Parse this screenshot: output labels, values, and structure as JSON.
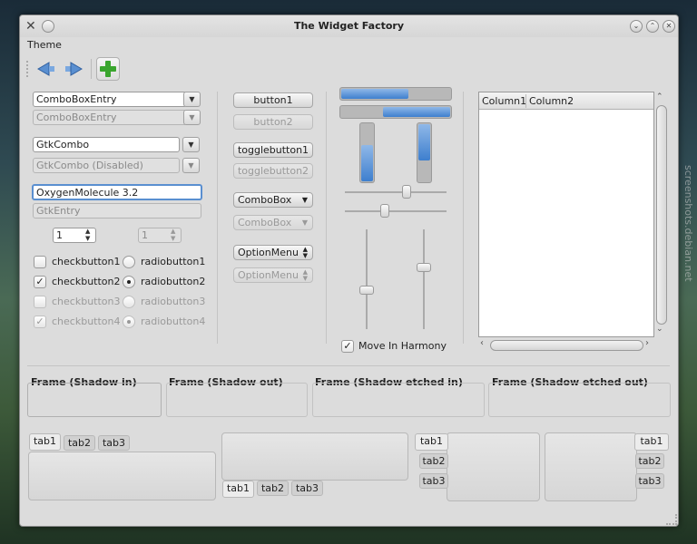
{
  "window": {
    "title": "The Widget Factory"
  },
  "menubar": {
    "theme": "Theme"
  },
  "left": {
    "combo_entry": "ComboBoxEntry",
    "combo_entry_dis": "ComboBoxEntry",
    "gtk_combo": "GtkCombo",
    "gtk_combo_dis": "GtkCombo (Disabled)",
    "entry": "OxygenMolecule 3.2",
    "entry_dis": "GtkEntry",
    "spin": "1",
    "spin_dis": "1",
    "check1": "checkbutton1",
    "check2": "checkbutton2",
    "check3": "checkbutton3",
    "check4": "checkbutton4",
    "radio1": "radiobutton1",
    "radio2": "radiobutton2",
    "radio3": "radiobutton3",
    "radio4": "radiobutton4"
  },
  "middle": {
    "button1": "button1",
    "button2": "button2",
    "toggle1": "togglebutton1",
    "toggle2": "togglebutton2",
    "combobox": "ComboBox",
    "combobox_dis": "ComboBox",
    "optionmenu": "OptionMenu",
    "optionmenu_dis": "OptionMenu"
  },
  "sliders": {
    "progress_h1": 0.6,
    "progress_h2": 0.6,
    "progress_v1": 0.6,
    "progress_v2": 0.6,
    "move_label": "Move In Harmony"
  },
  "tree": {
    "col1": "Column1",
    "col2": "Column2"
  },
  "frames": {
    "f1": "Frame (Shadow in)",
    "f2": "Frame (Shadow out)",
    "f3": "Frame (Shadow etched in)",
    "f4": "Frame (Shadow etched out)"
  },
  "tabs": {
    "t1": "tab1",
    "t2": "tab2",
    "t3": "tab3"
  },
  "watermark": "screenshots.debian.net"
}
